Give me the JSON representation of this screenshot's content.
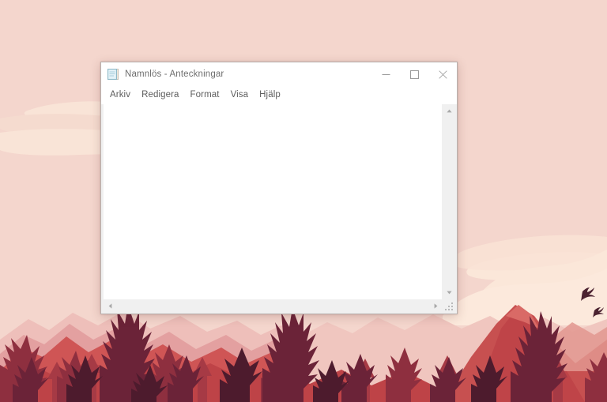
{
  "window": {
    "title": "Namnlös - Anteckningar",
    "icon": "notepad-icon",
    "controls": {
      "minimize": "−",
      "maximize": "□",
      "close": "✕"
    }
  },
  "menubar": {
    "items": [
      {
        "label": "Arkiv"
      },
      {
        "label": "Redigera"
      },
      {
        "label": "Format"
      },
      {
        "label": "Visa"
      },
      {
        "label": "Hjälp"
      }
    ]
  },
  "editor": {
    "value": "",
    "placeholder": ""
  },
  "scrollbars": {
    "vertical": {
      "up": "▲",
      "down": "▼"
    },
    "horizontal": {
      "left": "◀",
      "right": "▶"
    }
  },
  "desktop": {
    "wallpaper_name": "red-mountain-forest-wallpaper",
    "colors": {
      "sky": "#f4d6cd",
      "cloud_light": "#fbe6d8",
      "cloud_pale": "#f7ddd3",
      "mountain_far": "#eebfba",
      "mountain_mid": "#e59c9c",
      "mountain_near": "#cf5555",
      "mountain_dark": "#b83f42",
      "ridge_deep": "#a93540",
      "tree_mid": "#94303f",
      "tree_dark": "#6d2338",
      "tree_darkest": "#4b1a2c",
      "bird": "#4b2230"
    }
  }
}
